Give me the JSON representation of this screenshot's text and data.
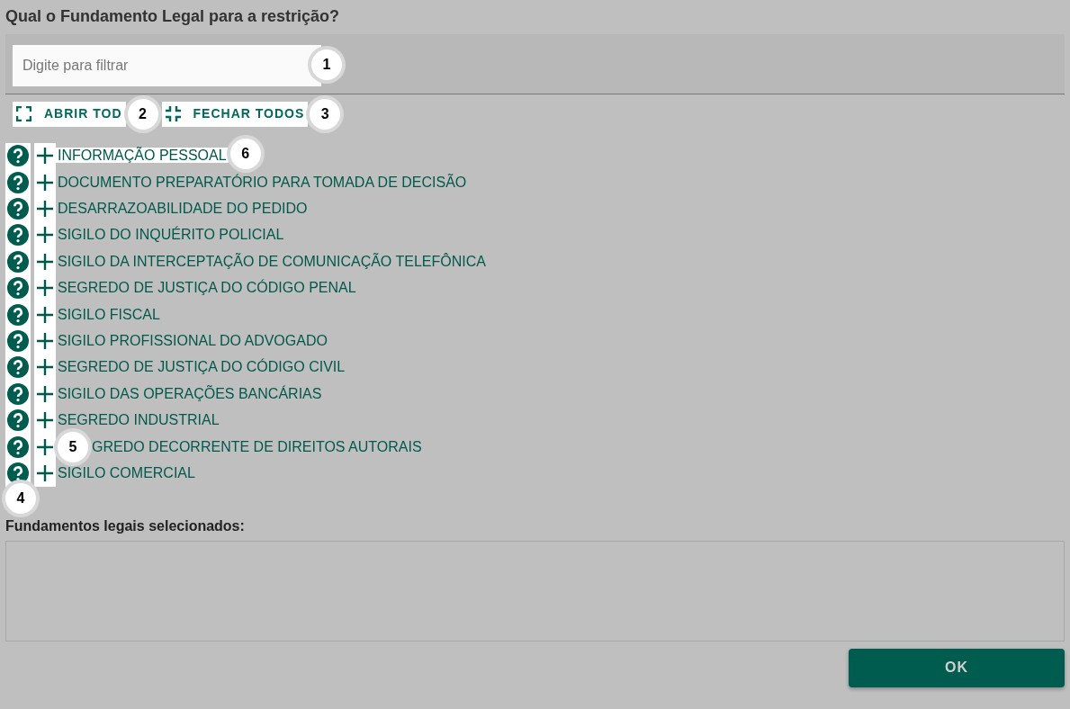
{
  "title": "Qual o Fundamento Legal para a restrição?",
  "filter": {
    "placeholder": "Digite para filtrar",
    "callout": "1"
  },
  "actions": [
    {
      "label": "ABRIR TOD",
      "kind": "expand",
      "callout": "2"
    },
    {
      "label": "FECHAR TODOS",
      "kind": "collapse",
      "callout": "3"
    }
  ],
  "tree": {
    "callout": "4",
    "items": [
      {
        "label": "INFORMAÇÃO PESSOAL",
        "highlighted": true,
        "badge_after": "6"
      },
      {
        "label": "DOCUMENTO PREPARATÓRIO PARA TOMADA DE DECISÃO",
        "highlighted": false
      },
      {
        "label": "DESARRAZOABILIDADE DO PEDIDO",
        "highlighted": false
      },
      {
        "label": "SIGILO DO INQUÉRITO POLICIAL",
        "highlighted": false
      },
      {
        "label": "SIGILO DA INTERCEPTAÇÃO DE COMUNICAÇÃO TELEFÔNICA",
        "highlighted": false
      },
      {
        "label": "SEGREDO DE JUSTIÇA DO CÓDIGO PENAL",
        "highlighted": false
      },
      {
        "label": "SIGILO FISCAL",
        "highlighted": false
      },
      {
        "label": "SIGILO PROFISSIONAL DO ADVOGADO",
        "highlighted": false
      },
      {
        "label": "SEGREDO DE JUSTIÇA DO CÓDIGO CIVIL",
        "highlighted": false
      },
      {
        "label": "SIGILO DAS OPERAÇÕES BANCÁRIAS",
        "highlighted": false
      },
      {
        "label": "SEGREDO INDUSTRIAL",
        "highlighted": false
      },
      {
        "label": "GREDO DECORRENTE DE DIREITOS AUTORAIS",
        "highlighted": false,
        "badge_before": "5"
      },
      {
        "label": "SIGILO COMERCIAL",
        "highlighted": false
      }
    ]
  },
  "selected_label": "Fundamentos legais selecionados:",
  "ok_button": "OK"
}
